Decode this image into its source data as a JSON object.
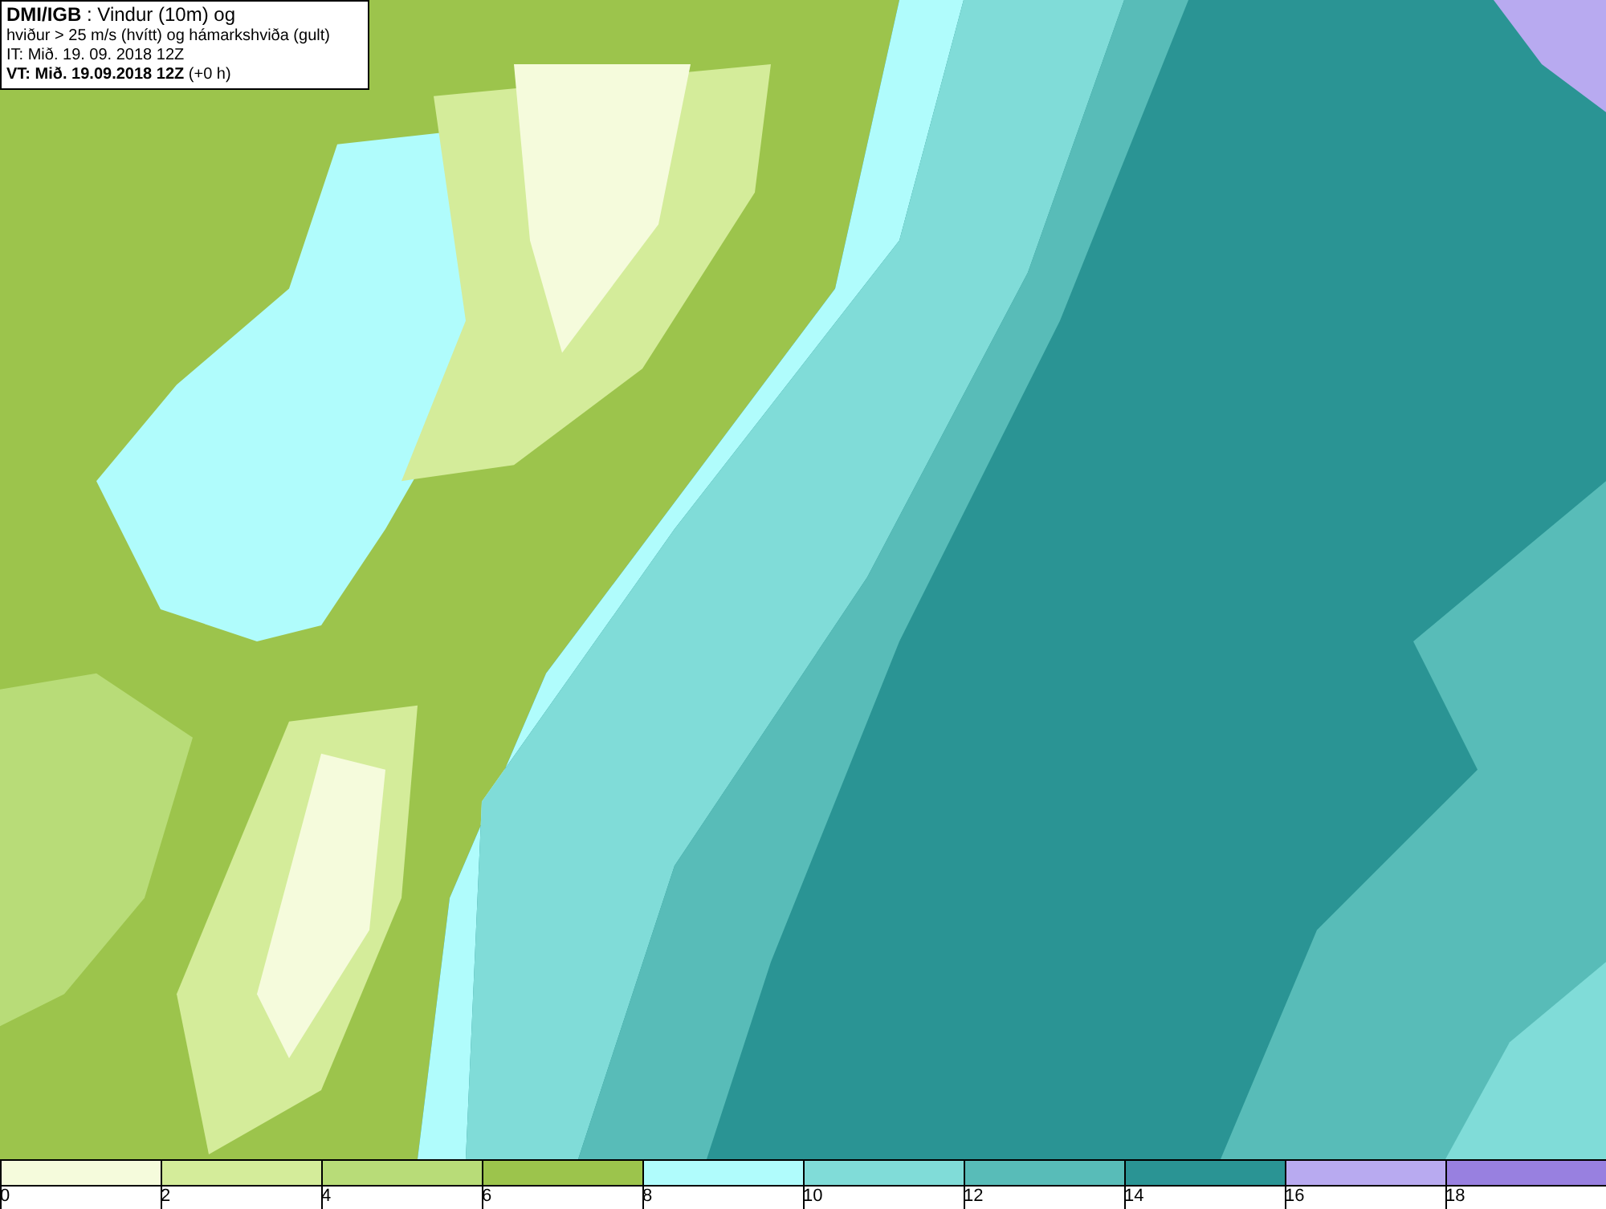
{
  "title_box": {
    "lines": [
      "**DMI/IGB** : Vindur (10m) og",
      "hviður > 25 m/s (hvítt) og hámarkshviða (gult)",
      "IT: Mið. 19. 09. 2018 12Z",
      "**VT: Mið. 19.09.2018 12Z** (+0 h)"
    ]
  },
  "legend": [
    {
      "color": "#f5fbdc",
      "label": "0"
    },
    {
      "color": "#d4ec9a",
      "label": "2"
    },
    {
      "color": "#b8dc78",
      "label": "4"
    },
    {
      "color": "#9cc44c",
      "label": "6"
    },
    {
      "color": "#b0fcfc",
      "label": "8"
    },
    {
      "color": "#80dcd8",
      "label": "10"
    },
    {
      "color": "#58bcb8",
      "label": "12"
    },
    {
      "color": "#2a9494",
      "label": "14"
    },
    {
      "color": "#b8aaf0",
      "label": "16"
    },
    {
      "color": "#9880e0",
      "label": "18"
    }
  ]
}
